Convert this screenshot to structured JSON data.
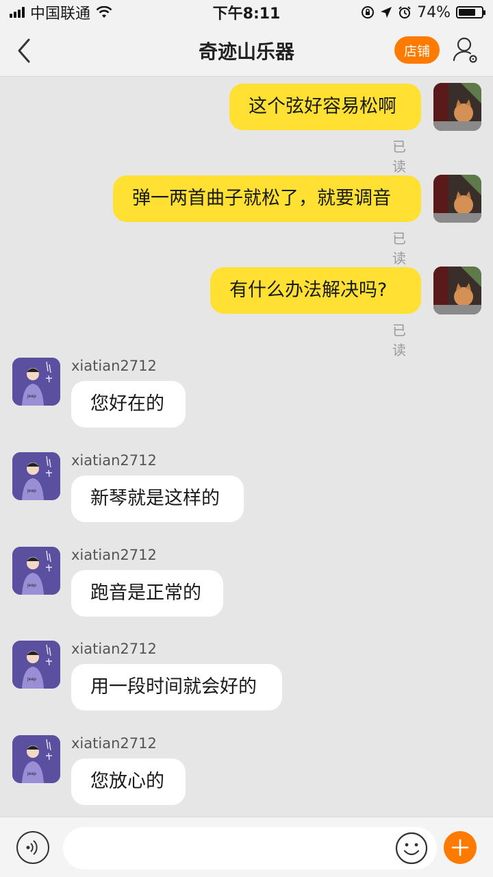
{
  "status_bar": {
    "carrier": "中国联通",
    "time": "下午8:11",
    "battery": "74%",
    "battery_level": 0.74
  },
  "nav": {
    "title": "奇迹山乐器",
    "shop_label": "店铺"
  },
  "messages": [
    {
      "direction": "out",
      "text": "这个弦好容易松啊",
      "status": "已读"
    },
    {
      "direction": "out",
      "text": "弹一两首曲子就松了，就要调音",
      "status": "已读"
    },
    {
      "direction": "out",
      "text": "有什么办法解决吗?",
      "status": "已读"
    },
    {
      "direction": "in",
      "sender": "xiatian2712",
      "text": "您好在的"
    },
    {
      "direction": "in",
      "sender": "xiatian2712",
      "text": "新琴就是这样的"
    },
    {
      "direction": "in",
      "sender": "xiatian2712",
      "text": "跑音是正常的"
    },
    {
      "direction": "in",
      "sender": "xiatian2712",
      "text": "用一段时间就会好的"
    },
    {
      "direction": "in",
      "sender": "xiatian2712",
      "text": "您放心的"
    }
  ],
  "avatar_shirt_text": "Jeep",
  "input": {
    "placeholder": "",
    "value": ""
  },
  "colors": {
    "accent": "#ff7a00",
    "outgoing_bubble": "#ffe033",
    "incoming_bubble": "#ffffff",
    "background": "#e6e6e6"
  }
}
